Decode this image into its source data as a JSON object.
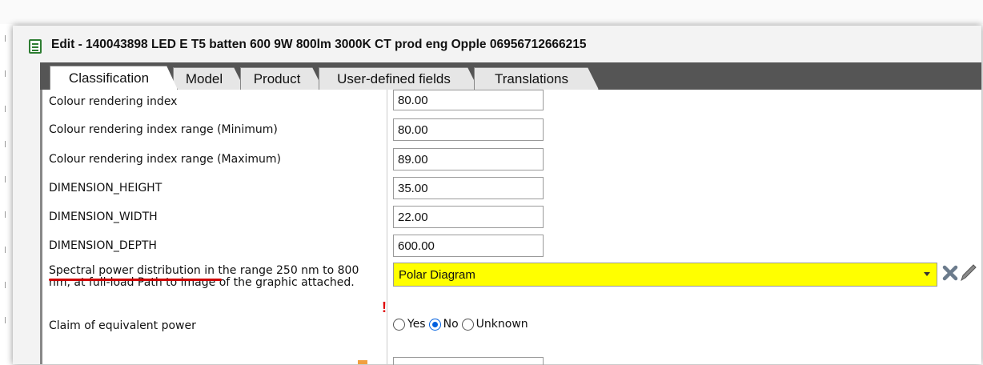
{
  "window": {
    "title": "Edit - 140043898 LED E T5 batten 600 9W 800lm 3000K CT prod eng Opple 06956712666215"
  },
  "tabs": [
    {
      "label": "Classification",
      "active": true
    },
    {
      "label": "Model",
      "active": false
    },
    {
      "label": "Product",
      "active": false
    },
    {
      "label": "User-defined fields",
      "active": false
    },
    {
      "label": "Translations",
      "active": false
    }
  ],
  "rows": [
    {
      "label": "Colour rendering index",
      "value": "80.00"
    },
    {
      "label": "Colour rendering index range (Minimum)",
      "value": "80.00"
    },
    {
      "label": "Colour rendering index range (Maximum)",
      "value": "89.00"
    },
    {
      "label": "DIMENSION_HEIGHT",
      "value": "35.00"
    },
    {
      "label": "DIMENSION_WIDTH",
      "value": "22.00"
    },
    {
      "label": "DIMENSION_DEPTH",
      "value": "600.00"
    }
  ],
  "spectral": {
    "label_highlight": "Spectral power distribution",
    "label_rest": " in the range 250 nm to 800 nm, at full-load Path to image of the graphic attached.",
    "required_mark": "!",
    "value": "Polar Diagram"
  },
  "claim": {
    "label": "Claim of equivalent power",
    "options": [
      {
        "label": "Yes",
        "selected": false
      },
      {
        "label": "No",
        "selected": true
      },
      {
        "label": "Unknown",
        "selected": false
      }
    ]
  },
  "colors": {
    "highlight_field": "#ffff00",
    "underline": "#d00000",
    "required": "#e00000",
    "tabbar": "#555555"
  },
  "icons": {
    "title": "form-icon",
    "clear": "clear-x-icon",
    "edit": "pencil-icon",
    "dropdown": "chevron-down-icon"
  }
}
